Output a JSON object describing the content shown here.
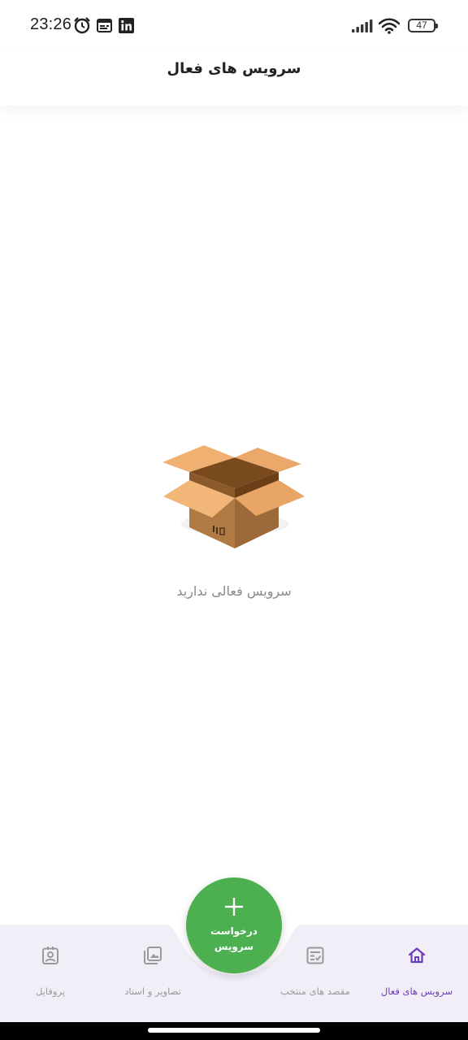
{
  "status_bar": {
    "time": "23:26",
    "battery_level": "47",
    "icons": [
      "alarm-icon",
      "notification-icon",
      "linkedin-icon",
      "signal-icon",
      "wifi-icon",
      "battery-icon"
    ]
  },
  "header": {
    "title": "سرویس های فعال"
  },
  "empty_state": {
    "icon": "open-box-icon",
    "message": "سرویس فعالی ندارید"
  },
  "fab": {
    "icon": "plus-icon",
    "label_line1": "درخواست",
    "label_line2": "سرویس",
    "color": "#4caf50"
  },
  "bottom_nav": {
    "background": "#f2eef8",
    "active_color": "#6a3eb8",
    "inactive_color": "#9a9a9a",
    "items": [
      {
        "label": "سرویس های فعال",
        "icon": "home-icon",
        "active": true
      },
      {
        "label": "مقصد های منتخب",
        "icon": "checklist-icon",
        "active": false
      },
      {
        "label": "تصاویر و اسناد",
        "icon": "gallery-icon",
        "active": false
      },
      {
        "label": "پروفایل",
        "icon": "profile-icon",
        "active": false
      }
    ]
  }
}
